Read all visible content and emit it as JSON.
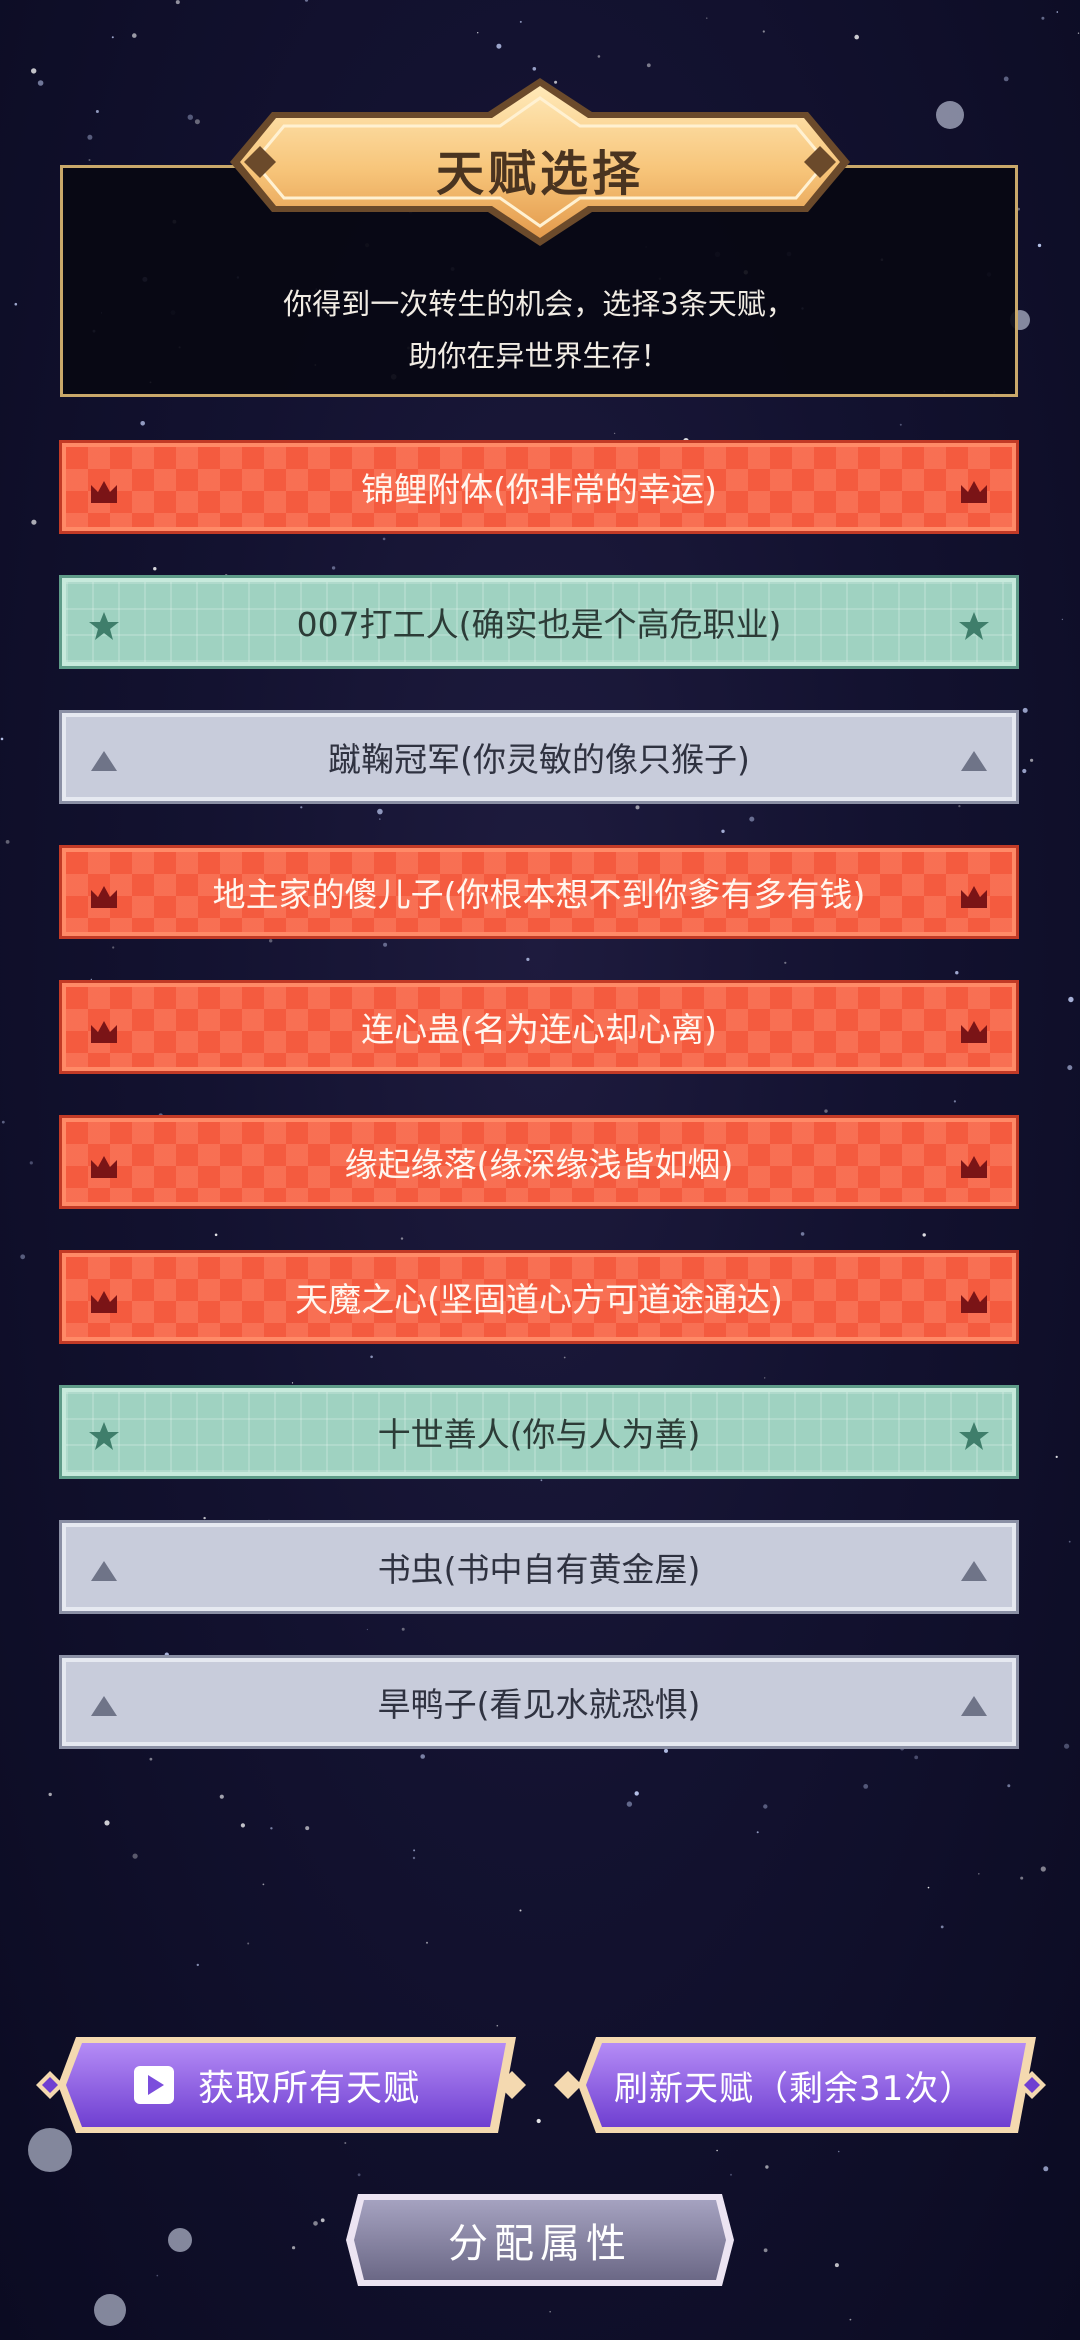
{
  "header": {
    "title": "天赋选择",
    "desc_line1": "你得到一次转生的机会，选择3条天赋，",
    "desc_line2": "助你在异世界生存！"
  },
  "talents": [
    {
      "label": "锦鲤附体(你非常的幸运)",
      "tier": "red",
      "icon": "crown-icon"
    },
    {
      "label": "007打工人(确实也是个高危职业)",
      "tier": "green",
      "icon": "star-icon"
    },
    {
      "label": "蹴鞠冠军(你灵敏的像只猴子)",
      "tier": "gray",
      "icon": "triangle-icon"
    },
    {
      "label": "地主家的傻儿子(你根本想不到你爹有多有钱)",
      "tier": "red",
      "icon": "crown-icon"
    },
    {
      "label": "连心蛊(名为连心却心离)",
      "tier": "red",
      "icon": "crown-icon"
    },
    {
      "label": "缘起缘落(缘深缘浅皆如烟)",
      "tier": "red",
      "icon": "crown-icon"
    },
    {
      "label": "天魔之心(坚固道心方可道途通达)",
      "tier": "red",
      "icon": "crown-icon"
    },
    {
      "label": "十世善人(你与人为善)",
      "tier": "green",
      "icon": "star-icon"
    },
    {
      "label": "书虫(书中自有黄金屋)",
      "tier": "gray",
      "icon": "triangle-icon"
    },
    {
      "label": "旱鸭子(看见水就恐惧)",
      "tier": "gray",
      "icon": "triangle-icon"
    }
  ],
  "buttons": {
    "get_all": "获取所有天赋",
    "refresh": "刷新天赋（剩余31次）",
    "allocate": "分配属性"
  },
  "colors": {
    "red_tier": "#f45b3f",
    "green_tier": "#9fd2c1",
    "gray_tier": "#c8ccdb",
    "purple_button": "#8a5fe0",
    "gold_frame": "#c9a86a"
  }
}
